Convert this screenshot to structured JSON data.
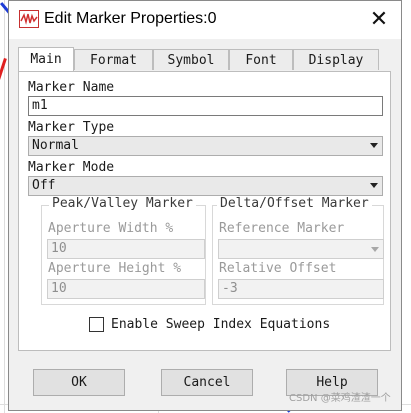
{
  "window": {
    "title": "Edit Marker Properties:0",
    "close_glyph": "✕"
  },
  "tabs": [
    {
      "label": "Main",
      "active": true
    },
    {
      "label": "Format",
      "active": false
    },
    {
      "label": "Symbol",
      "active": false
    },
    {
      "label": "Font",
      "active": false
    },
    {
      "label": "Display",
      "active": false
    }
  ],
  "main": {
    "marker_name": {
      "label": "Marker Name",
      "value": "m1"
    },
    "marker_type": {
      "label": "Marker Type",
      "value": "Normal"
    },
    "marker_mode": {
      "label": "Marker Mode",
      "value": "Off"
    },
    "peak_valley": {
      "title": "Peak/Valley Marker",
      "aperture_width": {
        "label": "Aperture Width %",
        "value": "10"
      },
      "aperture_height": {
        "label": "Aperture Height %",
        "value": "10"
      }
    },
    "delta_offset": {
      "title": "Delta/Offset Marker",
      "reference_marker": {
        "label": "Reference Marker",
        "value": ""
      },
      "relative_offset": {
        "label": "Relative Offset",
        "value": "-3"
      }
    },
    "sweep_index": {
      "label": "Enable Sweep Index Equations",
      "checked": false
    }
  },
  "buttons": {
    "ok": "OK",
    "cancel": "Cancel",
    "help": "Help"
  },
  "watermark": "CSDN @菜鸡渣渣一个"
}
